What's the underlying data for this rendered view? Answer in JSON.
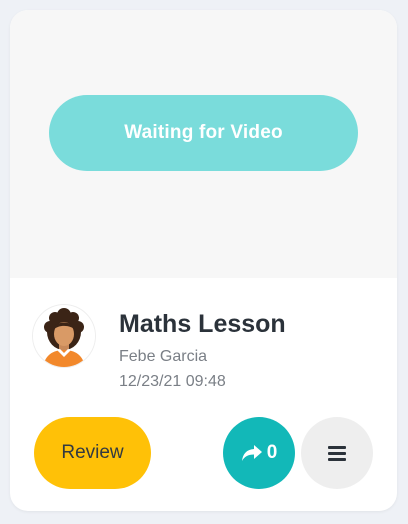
{
  "video": {
    "status_label": "Waiting for Video"
  },
  "lesson": {
    "title": "Maths Lesson",
    "teacher": "Febe Garcia",
    "datetime": "12/23/21 09:48"
  },
  "actions": {
    "review_label": "Review",
    "share_count": "0",
    "share_icon": "share-arrow-icon",
    "menu_icon": "hamburger-menu-icon"
  },
  "colors": {
    "waiting_pill": "#7adcdb",
    "review_button": "#ffc107",
    "share_button": "#12b8b8",
    "menu_button": "#eeeeee",
    "title_text": "#2b323a"
  }
}
